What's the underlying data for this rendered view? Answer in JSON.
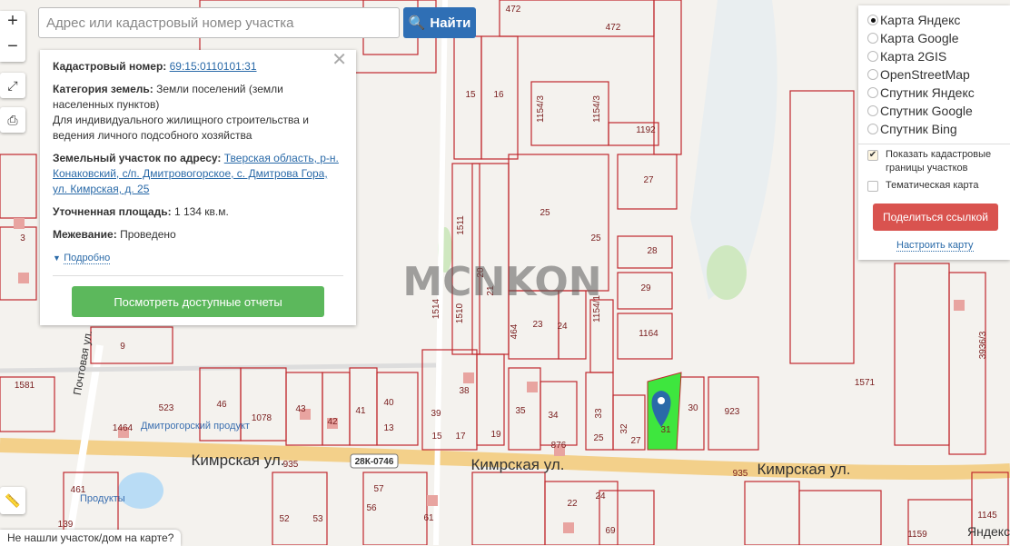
{
  "search": {
    "placeholder": "Адрес или кадастровый номер участка",
    "button": "Найти"
  },
  "zoom": {
    "in": "+",
    "out": "−"
  },
  "info": {
    "cadastral_label": "Кадастровый номер:",
    "cadastral_value": "69:15:0110101:31",
    "category_label": "Категория земель:",
    "category_value": "Земли поселений (земли населенных пунктов)",
    "use": "Для индивидуального жилищного строительства и ведения личного подсобного хозяйства",
    "address_label": "Земельный участок по адресу:",
    "address_value": "Тверская область, р-н. Конаковский, с/п. Дмитровогорское, с. Дмитрова Гора, ул. Кимрская, д. 25",
    "area_label": "Уточненная площадь:",
    "area_value": "1 134 кв.м.",
    "survey_label": "Межевание:",
    "survey_value": "Проведено",
    "more": "Подробно",
    "reports_button": "Посмотреть доступные отчеты"
  },
  "layers": {
    "options": [
      {
        "label": "Карта Яндекс",
        "selected": true
      },
      {
        "label": "Карта Google",
        "selected": false
      },
      {
        "label": "Карта 2GIS",
        "selected": false
      },
      {
        "label": "OpenStreetMap",
        "selected": false
      },
      {
        "label": "Спутник Яндекс",
        "selected": false
      },
      {
        "label": "Спутник Google",
        "selected": false
      },
      {
        "label": "Спутник Bing",
        "selected": false
      }
    ],
    "show_borders": {
      "label": "Показать кадастровые границы участков",
      "checked": true
    },
    "thematic": {
      "label": "Тематическая карта",
      "checked": false
    },
    "share": "Поделиться ссылкой",
    "configure": "Настроить карту"
  },
  "not_found": "Не нашли участок/дом на карте?",
  "map": {
    "streets": [
      "Кимрская ул.",
      "Кимрская ул.",
      "Кимрская ул.",
      "Почтовая ул."
    ],
    "road_code": "28К-0746",
    "watermark": "MCNKON",
    "poi": [
      "Дмитрогорский продукт",
      "Продукты"
    ],
    "parcels": [
      "472",
      "472",
      "15",
      "16",
      "1154/3",
      "1154/3",
      "1192",
      "27",
      "25",
      "25",
      "1511",
      "20",
      "21",
      "28",
      "29",
      "1164",
      "1514",
      "1510",
      "464",
      "23",
      "24",
      "1154/1",
      "38",
      "39",
      "35",
      "34",
      "33",
      "32",
      "27",
      "31",
      "30",
      "923",
      "46",
      "1078",
      "43",
      "42",
      "41",
      "40",
      "13",
      "15",
      "17",
      "19",
      "876",
      "25",
      "523",
      "1464",
      "935",
      "935",
      "1571",
      "3936/3",
      "1225",
      "61",
      "52",
      "53",
      "56",
      "57",
      "22",
      "24",
      "69",
      "1145",
      "1159",
      "1581",
      "9",
      "3",
      "461",
      "139"
    ],
    "highlight_color": "#3ee63e",
    "parcel_line_color": "#c0282d"
  },
  "brand": "Яндекс"
}
